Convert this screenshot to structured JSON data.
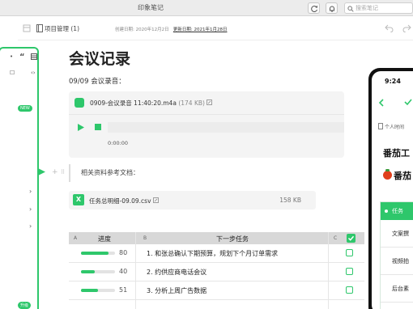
{
  "window": {
    "title": "印象笔记",
    "search_placeholder": "搜索笔记"
  },
  "note_info": {
    "notebook": "项目管理 (1)",
    "created": "创建日期: 2020年12月2日",
    "updated": "更新日期: 2021年1月28日"
  },
  "sidebar": {
    "quote_mark": "“",
    "new_badge": "NEW",
    "upgrade_badge": "升级",
    "chevrons": [
      "›",
      "›",
      "›"
    ]
  },
  "note": {
    "title": "会议记录",
    "audio_heading": "09/09 会议录音：",
    "audio_file": "0909-会议录音 11:40:20.m4a",
    "audio_size": "(174 KB)",
    "audio_time": "0:00:00",
    "refs_heading": "相关资料参考文档：",
    "csv_icon": "X",
    "csv_file": "任务总明细-09.09.csv",
    "csv_size": "158 KB"
  },
  "table": {
    "col_letters": [
      "A",
      "B",
      "C"
    ],
    "headers": [
      "进度",
      "下一步任务"
    ],
    "rows": [
      {
        "progress": 80,
        "task": "1. 和张总确认下期预算，规划下个月订单需求"
      },
      {
        "progress": 40,
        "task": "2. 约供应商电话会议"
      },
      {
        "progress": 51,
        "task": "3. 分析上周广告数据"
      }
    ]
  },
  "phone": {
    "time": "9:24",
    "notebook": "个人时间",
    "title1": "番茄工",
    "title2": "番茄",
    "table_header": "任务",
    "rows": [
      "文案撰",
      "视频拍",
      "后台素"
    ]
  },
  "colors": {
    "accent": "#2ec76b",
    "table_header_bg": "#d8d8d8"
  }
}
